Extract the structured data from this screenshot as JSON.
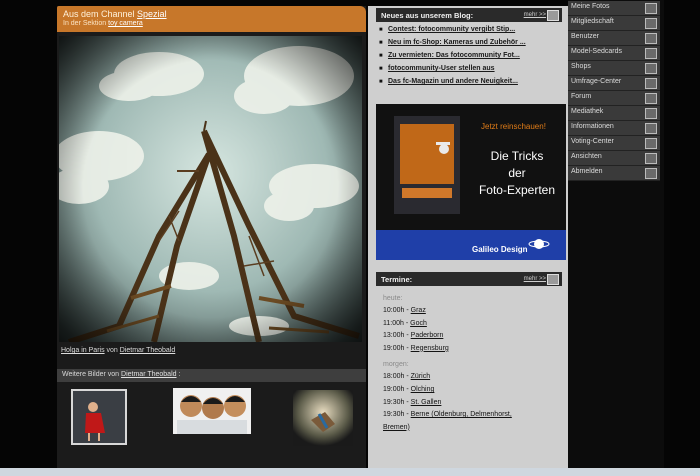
{
  "channel": {
    "prefix": "Aus dem Channel ",
    "name": "Spezial",
    "section_prefix": "In der Sektion ",
    "section": "toy camera"
  },
  "photo": {
    "title": "Holga in Paris",
    "by": " von ",
    "author": "Dietmar Theobald"
  },
  "more": {
    "prefix": "Weitere Bilder von ",
    "author": "Dietmar Theobald",
    "suffix": " :"
  },
  "blog": {
    "title": "Neues aus unserem Blog:",
    "more": "mehr >>",
    "items": [
      "Contest: fotocommunity vergibt Stip...",
      "Neu im fc-Shop: Kameras und Zubehör ...",
      "Zu vermieten: Das fotocommunity Fot...",
      "fotocommunity-User stellen aus",
      "Das fc-Magazin und andere Neuigkeit..."
    ]
  },
  "ad": {
    "teaser": "Jetzt reinschauen!",
    "headline_1": "Die Tricks",
    "headline_2": "der",
    "headline_3": "Foto-Experten",
    "publisher": "Galileo Design"
  },
  "termine": {
    "title": "Termine:",
    "more": "mehr >>",
    "today_label": "heute:",
    "today": [
      {
        "time": "10:00h",
        "place": "Graz"
      },
      {
        "time": "11:00h",
        "place": "Goch"
      },
      {
        "time": "13:00h",
        "place": "Paderborn"
      },
      {
        "time": "19:00h",
        "place": "Regensburg"
      }
    ],
    "tomorrow_label": "morgen:",
    "tomorrow": [
      {
        "time": "18:00h",
        "place": "Zürich"
      },
      {
        "time": "19:00h",
        "place": "Olching"
      },
      {
        "time": "19:30h",
        "place": "St. Gallen"
      },
      {
        "time": "19:30h",
        "place": "Berne (Oldenburg, Delmenhorst,"
      },
      {
        "time": "",
        "place": "Bremen)"
      }
    ]
  },
  "nav": {
    "items": [
      {
        "label": "Meine Fotos",
        "icon": "folder-icon"
      },
      {
        "label": "Mitgliedschaft",
        "icon": "card-icon"
      },
      {
        "label": "Benutzer",
        "icon": "users-icon"
      },
      {
        "label": "Model-Sedcards",
        "icon": "model-icon"
      },
      {
        "label": "Shops",
        "icon": "cart-icon"
      },
      {
        "label": "Umfrage-Center",
        "icon": "globe-icon"
      },
      {
        "label": "Forum",
        "icon": "chat-icon"
      },
      {
        "label": "Mediathek",
        "icon": "media-icon"
      },
      {
        "label": "Informationen",
        "icon": "info-icon"
      },
      {
        "label": "Voting-Center",
        "icon": "vote-icon"
      },
      {
        "label": "Ansichten",
        "icon": "eye-icon"
      },
      {
        "label": "Abmelden",
        "icon": "eject-icon"
      }
    ]
  },
  "colors": {
    "channel_bar": "#c7772a",
    "content_bg": "#1b1b1b",
    "sidebar_bg": "#cfcfcf",
    "nav_item_bg": "#3a3a3a"
  }
}
